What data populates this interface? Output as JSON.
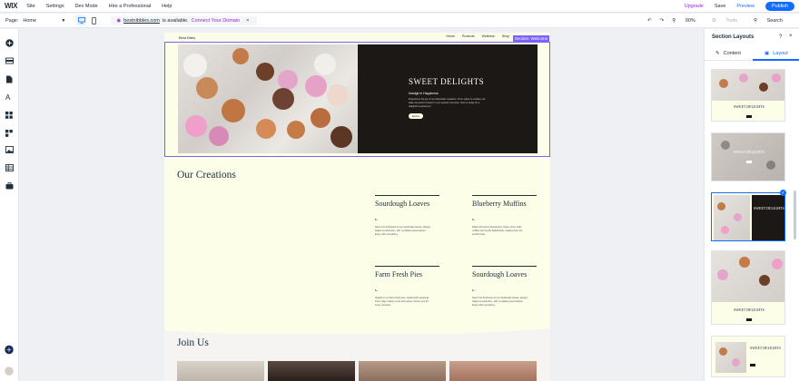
{
  "topbar": {
    "logo": "WIX",
    "menu": [
      "Site",
      "Settings",
      "Dev Mode",
      "Hire a Professional",
      "Help"
    ],
    "upgrade": "Upgrade",
    "save": "Save",
    "preview": "Preview",
    "publish": "Publish"
  },
  "pagebar": {
    "page_label": "Page:",
    "page_value": "Home",
    "domain": "bestnibbles.com",
    "domain_status": "is available.",
    "connect": "Connect Your Domain",
    "zoom": "90%",
    "tools": "Tools",
    "search": "Search"
  },
  "site": {
    "brand": "Best Bites",
    "nav": [
      "Home",
      "Products",
      "Wellness",
      "Shop"
    ],
    "section_label": "Section: Welcome",
    "hero": {
      "title": "SWEET DELIGHTS",
      "subtitle": "Indulge in Happiness",
      "text": "Experience the joy of our delectable creations. From cakes to cookies, we bake the perfect treats for your special moments. Visit us today for a delightful experience!",
      "button": "Explore"
    },
    "creations": {
      "heading": "Our Creations",
      "items": [
        {
          "title": "Sourdough Loaves",
          "price": "$--",
          "desc": "Savor the freshness of our handmade loaves, always baked to perfection, with no added preservatives. Enjoy with everything."
        },
        {
          "title": "Blueberry Muffins",
          "price": "$--",
          "desc": "Filled with plump blueberries, these moist, fluffy muffins are freshly baked daily, making them the perfect treat."
        },
        {
          "title": "Farm Fresh Pies",
          "price": "$--",
          "desc": "Delight in our farm-fresh pies, loaded with seasonal fruits, flaky, buttery crust and spices, there's one for every occasion."
        },
        {
          "title": "Sourdough Loaves",
          "price": "$--",
          "desc": "Savor the freshness of our handmade loaves, always baked to perfection, with no added preservatives. Enjoy with everything."
        }
      ]
    },
    "join": {
      "heading": "Join Us"
    }
  },
  "panel": {
    "title": "Section Layouts",
    "help": "?",
    "close": "×",
    "tabs": [
      "Content",
      "Layout"
    ],
    "active_tab": "Layout",
    "thumb_title": "SWEET DELIGHTS"
  },
  "colors": {
    "accent": "#116dff",
    "upgrade": "#9a27d5",
    "selection": "#7b61ff",
    "site_bg": "#fdfee8",
    "hero_dark": "#1b1816"
  }
}
